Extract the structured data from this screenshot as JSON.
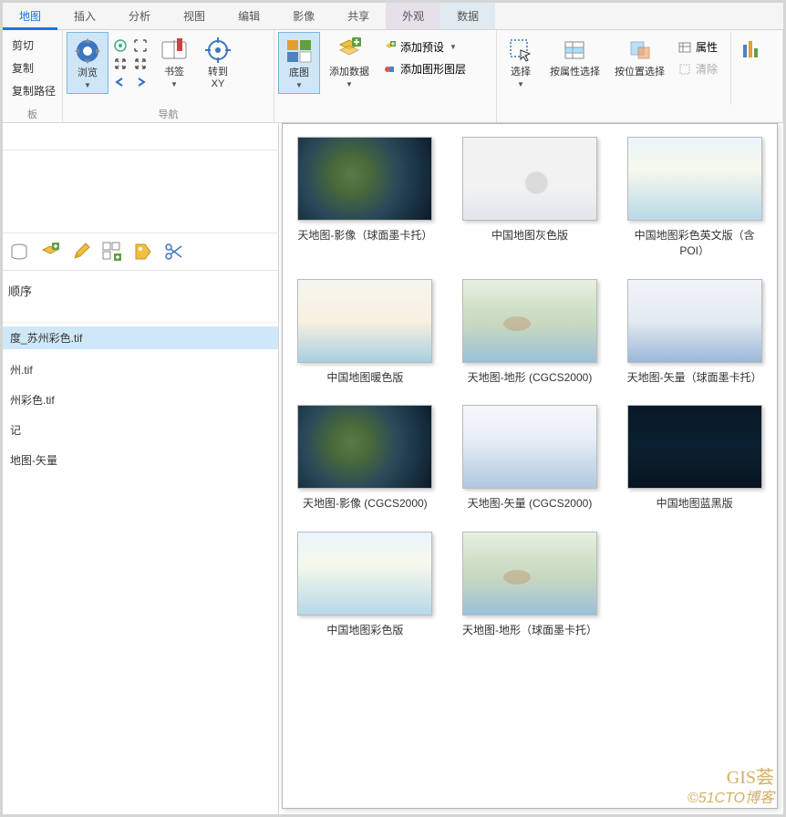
{
  "tabs": [
    {
      "label": "地图",
      "active": true
    },
    {
      "label": "插入"
    },
    {
      "label": "分析"
    },
    {
      "label": "视图"
    },
    {
      "label": "编辑"
    },
    {
      "label": "影像"
    },
    {
      "label": "共享"
    },
    {
      "label": "外观",
      "context": 1
    },
    {
      "label": "数据",
      "context": 2
    }
  ],
  "ribbon": {
    "clipboard": {
      "cut": "剪切",
      "copy": "复制",
      "copypath": "复制路径",
      "group": "板"
    },
    "navigate": {
      "browse": "浏览",
      "bookmark": "书签",
      "goto": "转到\nXY",
      "group": "导航"
    },
    "layer": {
      "basemap": "底图",
      "adddata": "添加数据",
      "addpreset": "添加预设",
      "addgraphic": "添加图形图层"
    },
    "selection": {
      "select": "选择",
      "byattr": "按属性选择",
      "byloc": "按位置选择",
      "attr": "属性",
      "clear": "清除"
    }
  },
  "left": {
    "section": "顺序",
    "items": [
      "度_苏州彩色.tif",
      "州.tif",
      "州彩色.tif",
      "记",
      "地图-矢量"
    ],
    "selectedIndex": 0
  },
  "gallery": [
    {
      "label": "天地图-影像（球面墨卡托）",
      "thumb": "t-sat"
    },
    {
      "label": "中国地图灰色版",
      "thumb": "t-gray"
    },
    {
      "label": "中国地图彩色英文版（含POI）",
      "thumb": "t-color"
    },
    {
      "label": "中国地图暖色版",
      "thumb": "t-warm"
    },
    {
      "label": "天地图-地形 (CGCS2000)",
      "thumb": "t-terrain"
    },
    {
      "label": "天地图-矢量（球面墨卡托）",
      "thumb": "t-vec"
    },
    {
      "label": "天地图-影像 (CGCS2000)",
      "thumb": "t-sat"
    },
    {
      "label": "天地图-矢量 (CGCS2000)",
      "thumb": "t-vec2"
    },
    {
      "label": "中国地图蓝黑版",
      "thumb": "t-dark"
    },
    {
      "label": "中国地图彩色版",
      "thumb": "t-color"
    },
    {
      "label": "天地图-地形（球面墨卡托）",
      "thumb": "t-terrain"
    }
  ],
  "watermark": {
    "line1": "GIS荟",
    "line2": "©51CTO博客"
  }
}
